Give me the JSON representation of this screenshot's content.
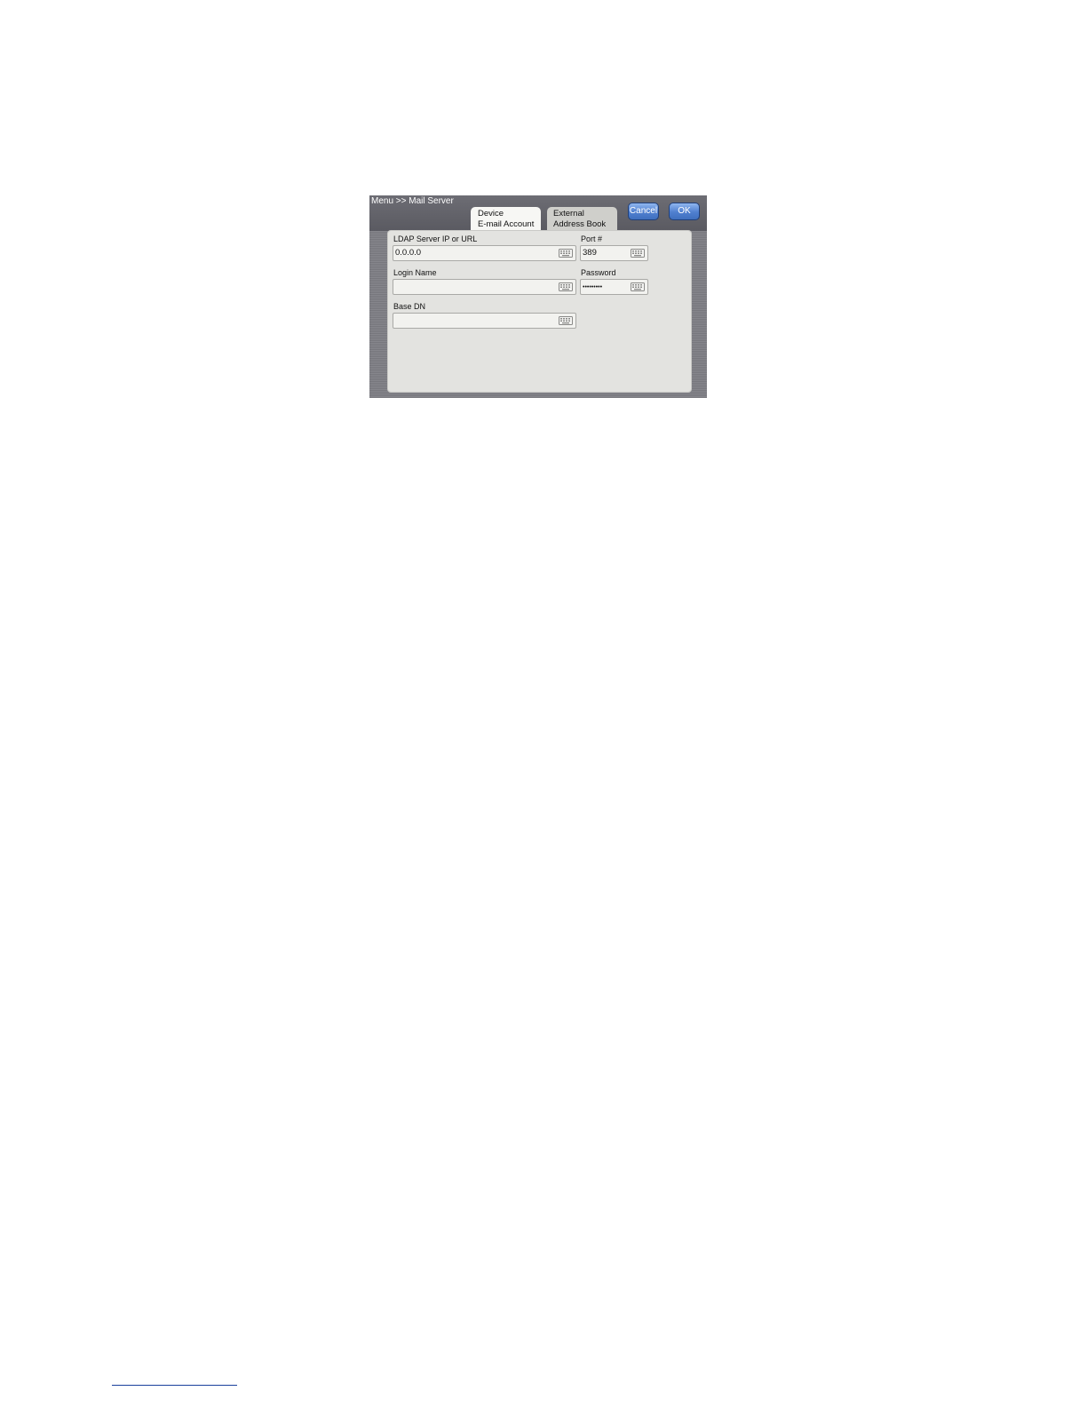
{
  "header": {
    "breadcrumb": "Menu >> Mail Server",
    "tabs": [
      {
        "line1": "Device",
        "line2": "E-mail Account",
        "active": true
      },
      {
        "line1": "External",
        "line2": "Address Book",
        "active": false
      }
    ],
    "cancel_label": "Cancel",
    "ok_label": "OK"
  },
  "form": {
    "ldap_server": {
      "label": "LDAP Server IP or URL",
      "value": "0.0.0.0"
    },
    "port": {
      "label": "Port #",
      "value": "389"
    },
    "login_name": {
      "label": "Login Name",
      "value": ""
    },
    "password": {
      "label": "Password",
      "value": "•••••••••"
    },
    "base_dn": {
      "label": "Base DN",
      "value": ""
    }
  },
  "icons": {
    "field_icon": "keyboard-icon"
  },
  "colors": {
    "button_blue": "#4f7fcf",
    "header_gray": "#5a5a61",
    "panel_bg": "#e3e3e0"
  }
}
